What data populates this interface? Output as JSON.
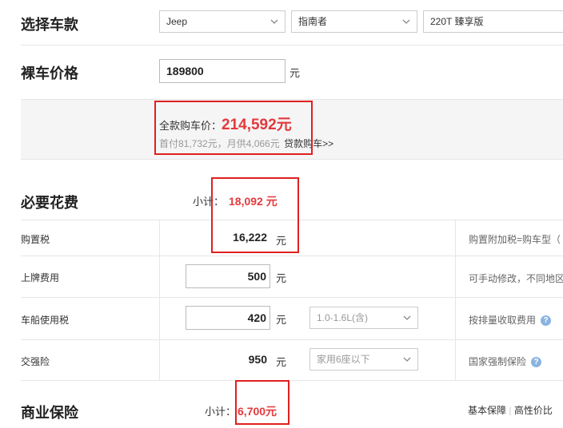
{
  "select_model": {
    "title": "选择车款",
    "brand": "Jeep",
    "series": "指南者",
    "trim": "220T 臻享版"
  },
  "bare_price": {
    "title": "裸车价格",
    "value": "189800",
    "unit": "元"
  },
  "summary": {
    "total_label": "全款购车价：",
    "total_value": "214,592元",
    "loan_info": "首付81,732元，月供4,066元",
    "loan_link": "贷款购车>>"
  },
  "required": {
    "title": "必要花费",
    "subtotal_label": "小计：",
    "subtotal_value": "18,092 元",
    "rows": [
      {
        "label": "购置税",
        "value": "16,222",
        "unit": "元",
        "note": "购置附加税=购车型（"
      },
      {
        "label": "上牌费用",
        "value": "500",
        "unit": "元",
        "note": "可手动修改，不同地区"
      },
      {
        "label": "车船使用税",
        "value": "420",
        "unit": "元",
        "select": "1.0-1.6L(含)",
        "note": "按排量收取费用"
      },
      {
        "label": "交强险",
        "value": "950",
        "unit": "元",
        "select": "家用6座以下",
        "note": "国家强制保险"
      }
    ]
  },
  "commercial": {
    "title": "商业保险",
    "subtotal_label": "小计：",
    "subtotal_value": "6,700元",
    "link_basic": "基本保障",
    "link_value": "高性价比",
    "link_divider": "|"
  },
  "colors": {
    "accent_red": "#e4393c",
    "box_red": "#e02020",
    "help_blue": "#8ab4e0"
  }
}
